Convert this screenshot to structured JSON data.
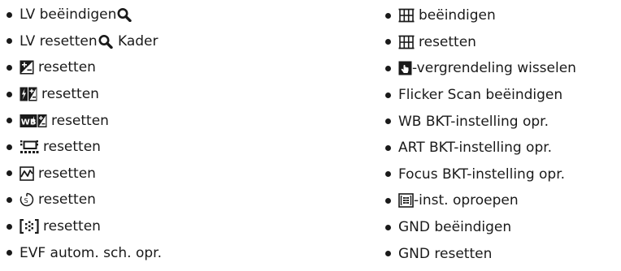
{
  "left_items": [
    {
      "icon": "magnify-icon",
      "before": "LV beëindigen",
      "after": ""
    },
    {
      "icon": "magnify-icon",
      "before": "LV resetten",
      "after": " Kader"
    },
    {
      "icon": "exposure-compensation-icon",
      "before": "",
      "after": "resetten"
    },
    {
      "icon": "flash-exposure-compensation-icon",
      "before": "",
      "after": "resetten"
    },
    {
      "icon": "white-balance-compensation-icon",
      "before": "",
      "after": "resetten"
    },
    {
      "icon": "drive-mode-icon",
      "before": "",
      "after": "resetten"
    },
    {
      "icon": "tone-curve-icon",
      "before": "",
      "after": "resetten"
    },
    {
      "icon": "self-timer-icon",
      "before": "",
      "after": "resetten"
    },
    {
      "icon": "af-target-icon",
      "before": "",
      "after": "resetten"
    },
    {
      "icon": "",
      "before": "EVF autom. sch. opr.",
      "after": ""
    }
  ],
  "right_items": [
    {
      "icon": "grid-icon",
      "before": "",
      "after": "beëindigen"
    },
    {
      "icon": "grid-icon",
      "before": "",
      "after": "resetten"
    },
    {
      "icon": "touch-lock-icon",
      "before": "",
      "after": "-vergrendeling wisselen"
    },
    {
      "icon": "",
      "before": "Flicker Scan beëindigen",
      "after": ""
    },
    {
      "icon": "",
      "before": "WB BKT-instelling opr.",
      "after": ""
    },
    {
      "icon": "",
      "before": "ART BKT-instelling opr.",
      "after": ""
    },
    {
      "icon": "",
      "before": "Focus BKT-instelling opr.",
      "after": ""
    },
    {
      "icon": "af-frame-icon",
      "before": "",
      "after": "-inst. oproepen"
    },
    {
      "icon": "",
      "before": "GND beëindigen",
      "after": ""
    },
    {
      "icon": "",
      "before": "GND resetten",
      "after": ""
    }
  ]
}
